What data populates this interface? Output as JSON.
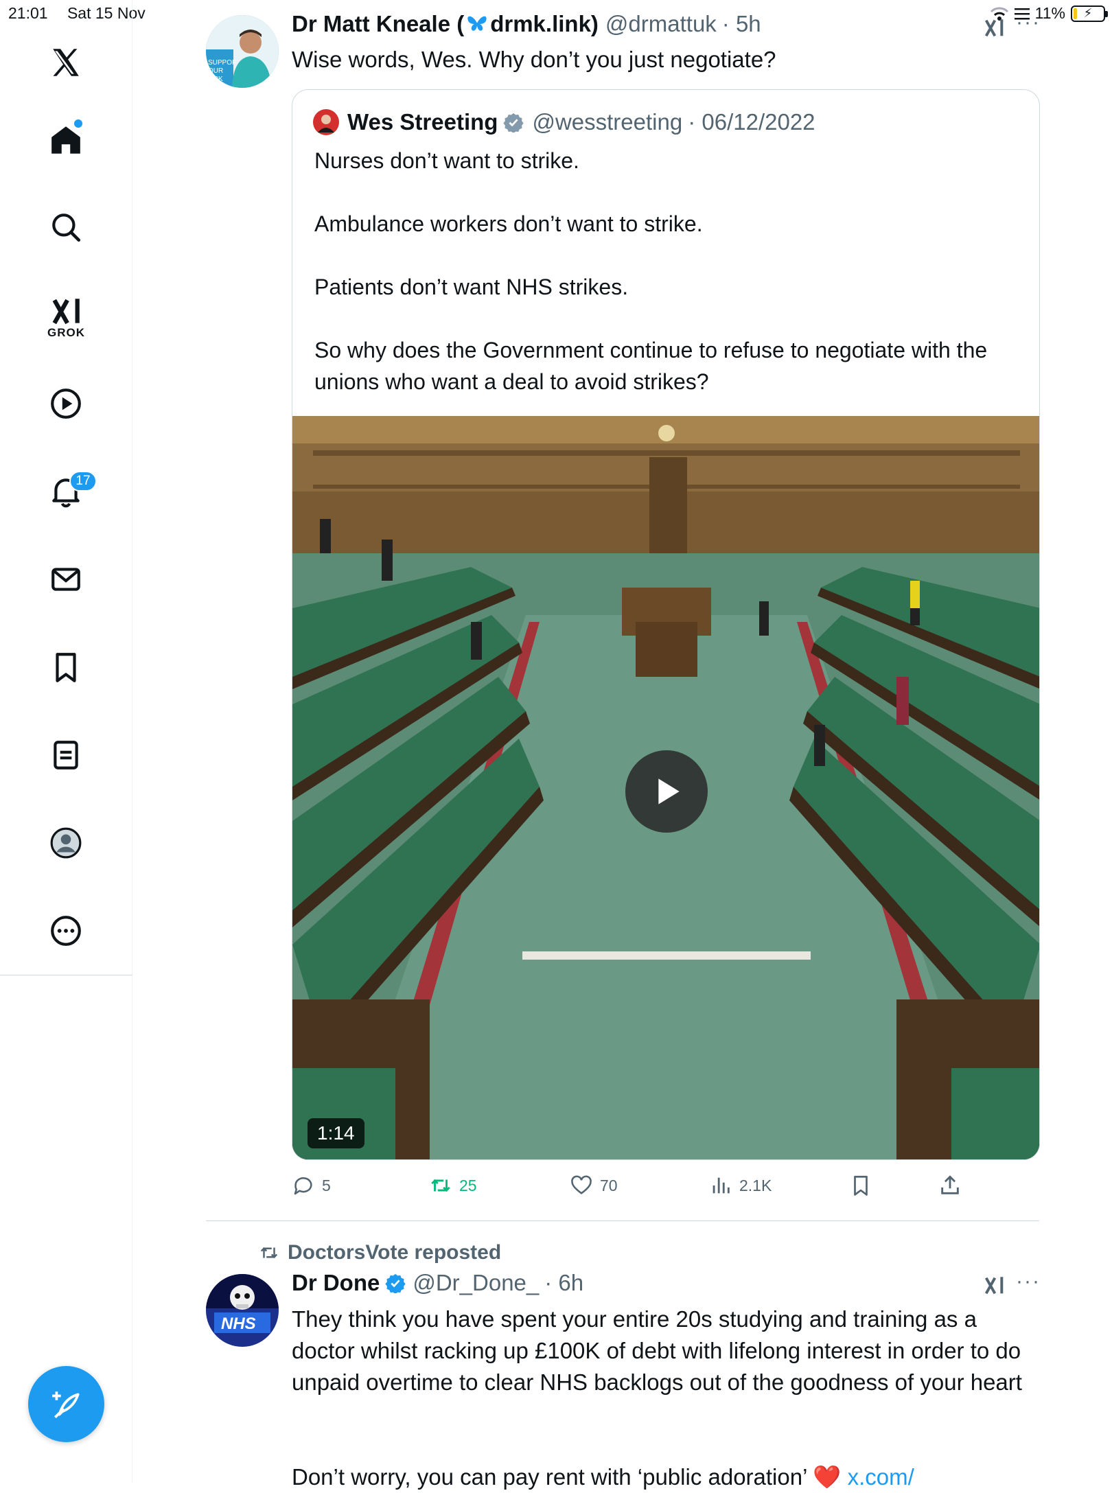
{
  "status_bar": {
    "time": "21:01",
    "date": "Sat 15 Nov",
    "battery": "11%",
    "battery_level": 0.11
  },
  "sidebar": {
    "grok_label": "GROK",
    "notifications_count": "17",
    "icons": [
      "x-logo-icon",
      "home-icon",
      "search-icon",
      "grok-icon",
      "video-icon",
      "notifications-icon",
      "messages-icon",
      "bookmarks-icon",
      "lists-icon",
      "profile-icon",
      "more-icon"
    ],
    "accent": "#1d9bf0"
  },
  "tweet1": {
    "name": "Dr Matt Kneale (",
    "name_suffix": "drmk.link)",
    "handle": "@drmattuk",
    "time": "· 5h",
    "text": "Wise words, Wes. Why don’t you just negotiate?",
    "avatar_text": [
      "SUPPOF",
      "OUR",
      "ORK"
    ],
    "quote": {
      "name": "Wes Streeting",
      "handle": "@wesstreeting",
      "date": "· 06/12/2022",
      "text": "Nurses don’t want to strike.\n\nAmbulance workers don’t want to strike.\n\nPatients don’t want NHS strikes.\n\nSo why does the Government continue to refuse to negotiate with the unions who want a deal to avoid strikes?",
      "video_duration": "1:14"
    },
    "actions": {
      "replies": "5",
      "reposts": "25",
      "likes": "70",
      "views": "2.1K"
    }
  },
  "tweet2": {
    "reposted_by": "DoctorsVote reposted",
    "name": "Dr Done",
    "handle": "@Dr_Done_",
    "time": "· 6h",
    "text": "They think you have spent your entire 20s studying and training as a doctor whilst racking up £100K of debt with lifelong interest in order to do unpaid overtime to clear NHS backlogs out of the goodness of your heart",
    "text2": "Don’t worry, you can pay rent with ‘public adoration’",
    "link": "x.com/",
    "avatar_text": "NHS"
  },
  "colors": {
    "accent": "#1d9bf0",
    "repost_green": "#00ba7c",
    "muted": "#536471"
  }
}
